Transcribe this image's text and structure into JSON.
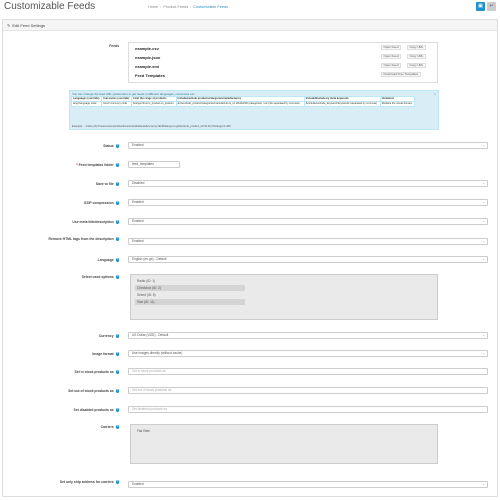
{
  "header": {
    "title": "Customizable Feeds",
    "breadcrumbs": [
      "Home",
      "Product Feeds",
      "Customizable Feeds"
    ],
    "save_icon": "save-icon",
    "back_icon": "reply-icon"
  },
  "panel": {
    "heading": "Edit Feed Settings",
    "heading_icon": "pencil-icon"
  },
  "feeds": {
    "label": "Feeds",
    "items": [
      {
        "name": "example.csv",
        "open": "Open Feed",
        "copy": "Copy URL"
      },
      {
        "name": "example.json",
        "open": "Open Feed",
        "copy": "Copy URL"
      },
      {
        "name": "example.xml",
        "open": "Open Feed",
        "copy": "Copy URL"
      }
    ],
    "templates_label": "Feed Templates",
    "download_label": "Download Free Templates"
  },
  "info": {
    "intro": "You can change the feed URL parameters to get feeds in different languages, currencies etc.:",
    "columns": [
      "Languages (override)",
      "Currencies (override)",
      "Limit the range of products",
      "Include/exclude products/categories/manufacturers",
      "Include/Exclude by meta keywords",
      "Variations"
    ],
    "row": [
      "lang=language code",
      "&curr=currency code",
      "&range=from/n_product-to_product",
      "&in/exclude_product/categories/manufacturers_id: id1/id2/id3 (categories) / etc (ids separated by commas)",
      "&include/exclude_keyword=keywords (separated by commas)",
      "Replace the visual domain"
    ],
    "example": "Example: .../index.php?route=extension/feed/customizablefeeds&currency=EUR&lang=en-gb&include_product_id=42,30,47&range=1-300"
  },
  "fields": {
    "status": {
      "label": "Status",
      "value": "Enabled"
    },
    "templates_folder": {
      "label": "Feed templates folder",
      "value": "feed_templates"
    },
    "save_to_file": {
      "label": "Save to file",
      "value": "Disabled"
    },
    "gzip": {
      "label": "GZIP compression",
      "value": "Enabled"
    },
    "meta_desc": {
      "label": "Use meta title/description",
      "value": "Enabled"
    },
    "remove_html": {
      "label": "Remove HTML tags from the description",
      "value": "Enabled"
    },
    "language": {
      "label": "Language",
      "value": "English (en-gb) - Default"
    },
    "select_options": {
      "label": "Select used options",
      "options": [
        "Radio (ID: 1)",
        "Checkbox (ID: 2)",
        "Select (ID: 5)",
        "Size (ID: 11)"
      ]
    },
    "currency": {
      "label": "Currency",
      "value": "US Dollar (USD) - Default"
    },
    "image_format": {
      "label": "Image format",
      "value": "Use images directly (without cache)"
    },
    "in_stock": {
      "label": "Set in stock products as",
      "placeholder": "Set in stock products as"
    },
    "out_stock": {
      "label": "Set out of stock products as",
      "placeholder": "Set out of stock products as"
    },
    "disabled": {
      "label": "Set disabled products as",
      "placeholder": "Set disabled products as"
    },
    "carriers": {
      "label": "Carriers",
      "options": [
        "Flat Rate"
      ]
    },
    "ship_address": {
      "label": "Set only ship address for carriers",
      "value": "Enabled"
    }
  }
}
